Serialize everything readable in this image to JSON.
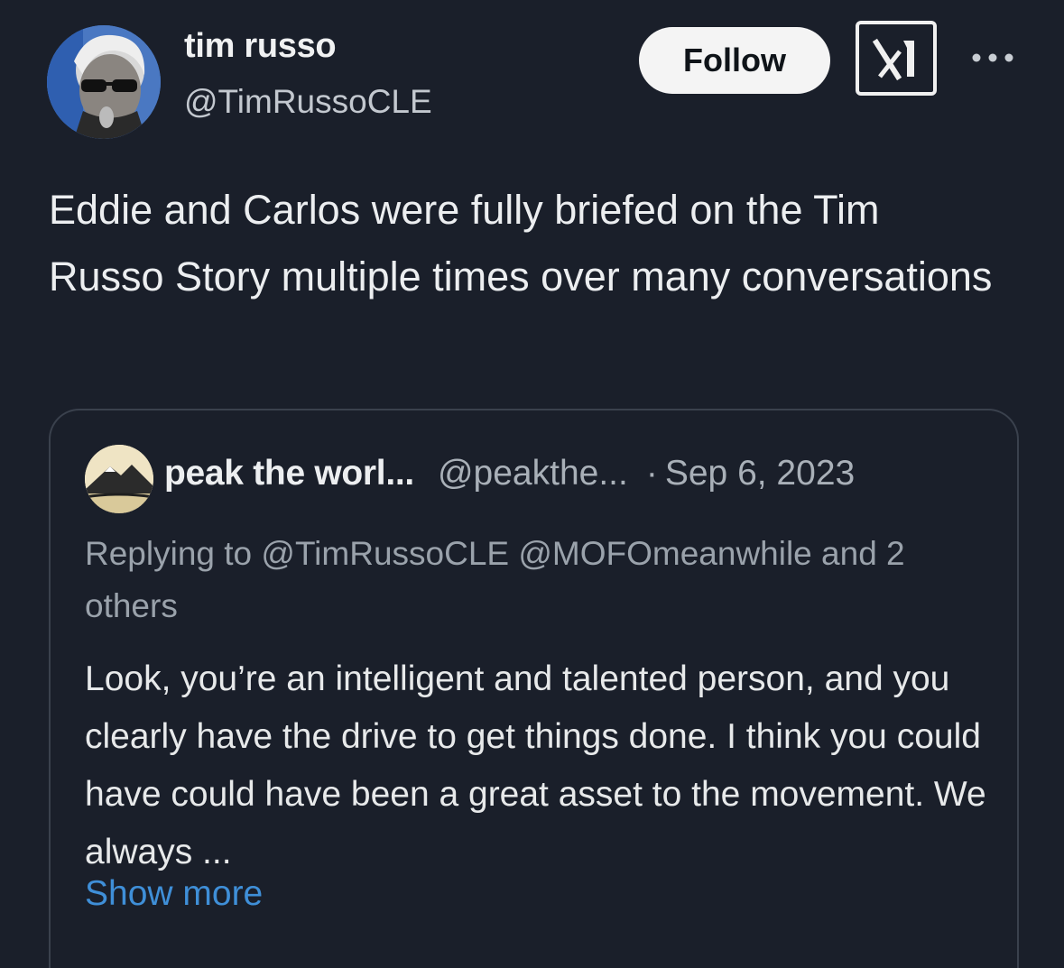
{
  "author": {
    "name": "tim russo",
    "handle": "@TimRussoCLE",
    "avatar_icon": "profile-photo-icon"
  },
  "actions": {
    "follow_label": "Follow",
    "grok_icon": "grok-icon",
    "more_icon": "more-horizontal-icon"
  },
  "tweet": {
    "text": "Eddie and Carlos were fully briefed on the Tim Russo Story multiple times over many conversations"
  },
  "quoted_tweet": {
    "name": "peak the worl...",
    "handle": "@peakthe...",
    "separator": "·",
    "date": "Sep 6, 2023",
    "replying_to": "Replying to @TimRussoCLE @MOFOmeanwhile and 2 others",
    "text": "Look, you’re an intelligent and talented person, and you clearly have the drive to get things done.  I think you could have could have been a great asset to the movement.  We always ...",
    "show_more_label": "Show more"
  },
  "colors": {
    "background": "#1a1f2a",
    "link": "#3f8fd8",
    "secondary_text": "#a9b0b8",
    "border": "#3a414d"
  }
}
